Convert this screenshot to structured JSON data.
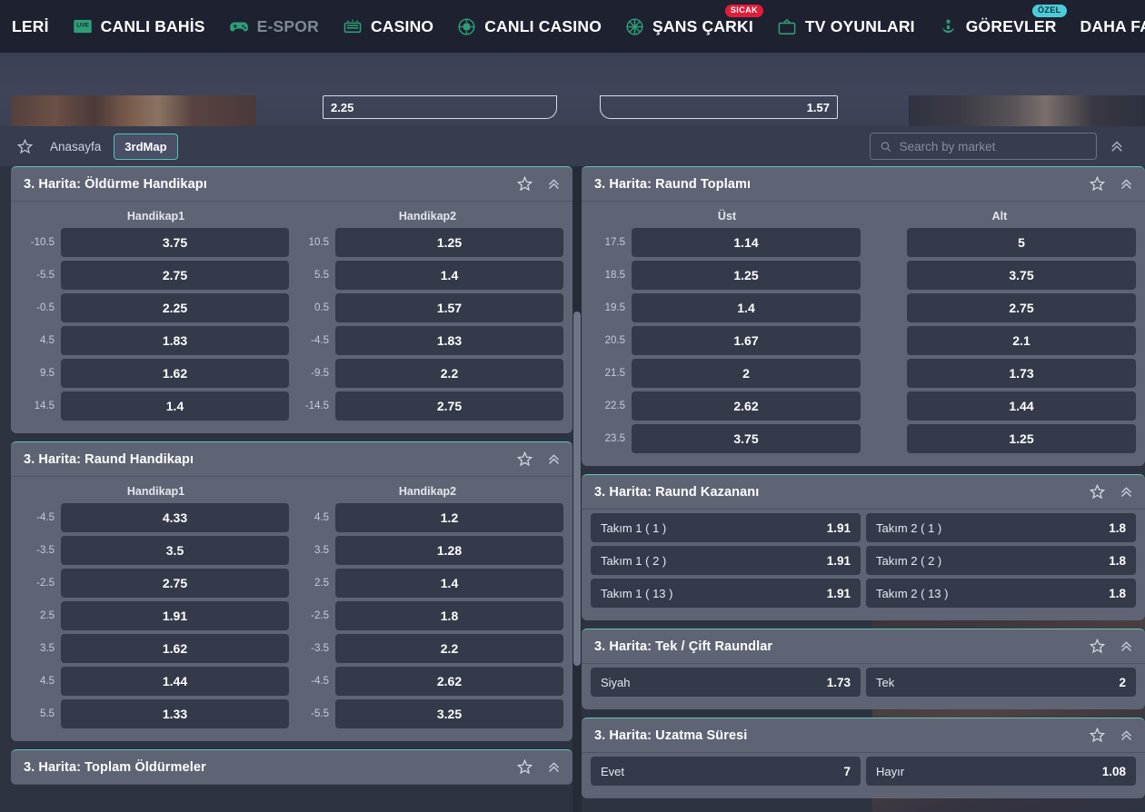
{
  "topnav": {
    "items": [
      {
        "label": "LERİ",
        "icon": null,
        "dim": false,
        "badge": null,
        "truncated": true
      },
      {
        "label": "CANLI BAHİS",
        "icon": "live-tv-icon",
        "dim": false,
        "badge": null
      },
      {
        "label": "E-SPOR",
        "icon": "gamepad-icon",
        "dim": true,
        "badge": null
      },
      {
        "label": "CASINO",
        "icon": "slot-machine-icon",
        "dim": false,
        "badge": null
      },
      {
        "label": "CANLI CASINO",
        "icon": "casino-chip-icon",
        "dim": false,
        "badge": null
      },
      {
        "label": "ŞANS ÇARKI",
        "icon": "wheel-icon",
        "dim": false,
        "badge": "SICAK",
        "badge_kind": "hot"
      },
      {
        "label": "TV OYUNLARI",
        "icon": "television-icon",
        "dim": false,
        "badge": null
      },
      {
        "label": "GÖREVLER",
        "icon": "trophy-person-icon",
        "dim": false,
        "badge": "ÖZEL",
        "badge_kind": "special"
      },
      {
        "label": "DAHA FAZLASI",
        "icon": null,
        "dim": false,
        "badge": null
      }
    ]
  },
  "banner": {
    "odd_left": "2.25",
    "odd_right": "1.57"
  },
  "toolbar": {
    "favorite_icon": "star-icon",
    "breadcrumb_home": "Anasayfa",
    "active_tab": "3rdMap",
    "search": {
      "placeholder": "Search by market",
      "value": "",
      "icon": "search-icon"
    },
    "collapse_icon": "chevron-double-up-icon"
  },
  "left_column": [
    {
      "title": "3. Harita: Öldürme Handikapı",
      "layout": "handicap",
      "headers": [
        "Handikap1",
        "Handikap2"
      ],
      "rows": [
        {
          "l_line": "-10.5",
          "l_odd": "3.75",
          "r_line": "10.5",
          "r_odd": "1.25"
        },
        {
          "l_line": "-5.5",
          "l_odd": "2.75",
          "r_line": "5.5",
          "r_odd": "1.4"
        },
        {
          "l_line": "-0.5",
          "l_odd": "2.25",
          "r_line": "0.5",
          "r_odd": "1.57"
        },
        {
          "l_line": "4.5",
          "l_odd": "1.83",
          "r_line": "-4.5",
          "r_odd": "1.83"
        },
        {
          "l_line": "9.5",
          "l_odd": "1.62",
          "r_line": "-9.5",
          "r_odd": "2.2"
        },
        {
          "l_line": "14.5",
          "l_odd": "1.4",
          "r_line": "-14.5",
          "r_odd": "2.75"
        }
      ]
    },
    {
      "title": "3. Harita: Raund Handikapı",
      "layout": "handicap",
      "headers": [
        "Handikap1",
        "Handikap2"
      ],
      "rows": [
        {
          "l_line": "-4.5",
          "l_odd": "4.33",
          "r_line": "4.5",
          "r_odd": "1.2"
        },
        {
          "l_line": "-3.5",
          "l_odd": "3.5",
          "r_line": "3.5",
          "r_odd": "1.28"
        },
        {
          "l_line": "-2.5",
          "l_odd": "2.75",
          "r_line": "2.5",
          "r_odd": "1.4"
        },
        {
          "l_line": "2.5",
          "l_odd": "1.91",
          "r_line": "-2.5",
          "r_odd": "1.8"
        },
        {
          "l_line": "3.5",
          "l_odd": "1.62",
          "r_line": "-3.5",
          "r_odd": "2.2"
        },
        {
          "l_line": "4.5",
          "l_odd": "1.44",
          "r_line": "-4.5",
          "r_odd": "2.62"
        },
        {
          "l_line": "5.5",
          "l_odd": "1.33",
          "r_line": "-5.5",
          "r_odd": "3.25"
        }
      ]
    },
    {
      "title": "3. Harita: Toplam Öldürmeler",
      "layout": "header-only",
      "headers": [],
      "rows": []
    }
  ],
  "right_column": [
    {
      "title": "3. Harita: Raund Toplamı",
      "layout": "handicap",
      "headers": [
        "Üst",
        "Alt"
      ],
      "rows": [
        {
          "l_line": "17.5",
          "l_odd": "1.14",
          "r_line": "",
          "r_odd": "5"
        },
        {
          "l_line": "18.5",
          "l_odd": "1.25",
          "r_line": "",
          "r_odd": "3.75"
        },
        {
          "l_line": "19.5",
          "l_odd": "1.4",
          "r_line": "",
          "r_odd": "2.75"
        },
        {
          "l_line": "20.5",
          "l_odd": "1.67",
          "r_line": "",
          "r_odd": "2.1"
        },
        {
          "l_line": "21.5",
          "l_odd": "2",
          "r_line": "",
          "r_odd": "1.73"
        },
        {
          "l_line": "22.5",
          "l_odd": "2.62",
          "r_line": "",
          "r_odd": "1.44"
        },
        {
          "l_line": "23.5",
          "l_odd": "3.75",
          "r_line": "",
          "r_odd": "1.25"
        }
      ]
    },
    {
      "title": "3. Harita: Raund Kazananı",
      "layout": "pairs",
      "rows": [
        {
          "l_name": "Takım 1 ( 1 )",
          "l_odd": "1.91",
          "r_name": "Takım 2 ( 1 )",
          "r_odd": "1.8"
        },
        {
          "l_name": "Takım 1 ( 2 )",
          "l_odd": "1.91",
          "r_name": "Takım 2 ( 2 )",
          "r_odd": "1.8"
        },
        {
          "l_name": "Takım 1 ( 13 )",
          "l_odd": "1.91",
          "r_name": "Takım 2 ( 13 )",
          "r_odd": "1.8"
        }
      ]
    },
    {
      "title": "3. Harita: Tek / Çift Raundlar",
      "layout": "pairs",
      "rows": [
        {
          "l_name": "Siyah",
          "l_odd": "1.73",
          "r_name": "Tek",
          "r_odd": "2"
        }
      ]
    },
    {
      "title": "3. Harita: Uzatma Süresi",
      "layout": "pairs",
      "rows": [
        {
          "l_name": "Evet",
          "l_odd": "7",
          "r_name": "Hayır",
          "r_odd": "1.08"
        }
      ]
    }
  ],
  "colors": {
    "nav_bg": "#1d2130",
    "page_bg": "#2e3342",
    "card_bg": "#5f6474",
    "odds_bg": "#343a4a",
    "accent_teal": "#64c3b4",
    "accent_green": "#2e9e78",
    "badge_hot": "#e11d3a",
    "badge_special": "#4ecbd9"
  }
}
